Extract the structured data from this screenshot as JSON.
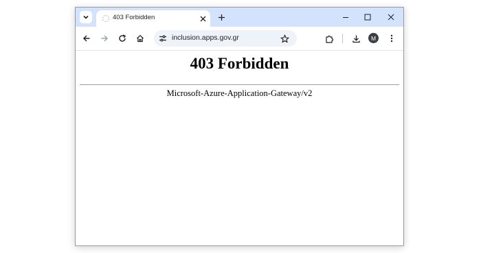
{
  "browser": {
    "tab": {
      "title": "403 Forbidden",
      "favicon": "loading-spinner-icon"
    },
    "omnibox": {
      "url": "inclusion.apps.gov.gr"
    },
    "profile": {
      "initial": "M"
    },
    "icons": {
      "tab_search": "chevron-down-icon",
      "tab_close": "close-icon",
      "new_tab": "plus-icon",
      "minimize": "minimize-icon",
      "maximize": "maximize-icon",
      "close_window": "close-icon",
      "back": "arrow-left-icon",
      "forward": "arrow-right-icon",
      "reload": "reload-icon",
      "home": "home-icon",
      "site_settings": "tune-icon",
      "bookmark": "star-icon",
      "extensions": "puzzle-icon",
      "downloads": "download-icon",
      "menu": "kebab-menu-icon"
    },
    "colors": {
      "tabstrip": "#d3e3fd",
      "omnibox": "#eef2f9",
      "avatar": "#3c4043"
    }
  },
  "page": {
    "heading": "403 Forbidden",
    "server_signature": "Microsoft-Azure-Application-Gateway/v2"
  }
}
